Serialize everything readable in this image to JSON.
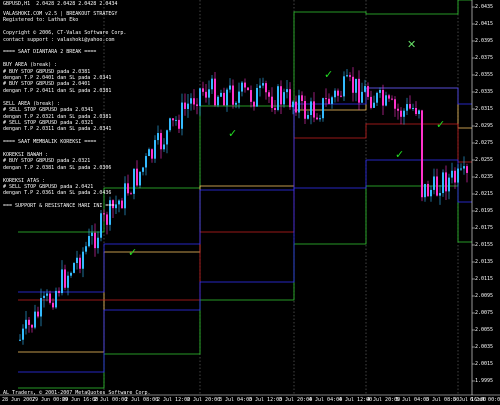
{
  "header": {
    "title": "GBPUSD,H1  2.0428 2.0428 2.0428 2.0434"
  },
  "info_lines": [
    "VALASHOKI.COM v2.5 | BREAKOUT STRATEGY",
    "Registered to: Lathan Eko",
    "",
    "Copyright © 2006, CT-Valas Software Corp.",
    "contact support : valashoki@yahoo.com",
    "",
    "==== SAAT DIANTARA 2 BREAK ====",
    "",
    "BUY AREA (break) :",
    "# BUY STOP GBPUSD pada 2.0381",
    "dengan T.P 2.0401 dan SL pada 2.0341",
    "# BUY STOP GBPUSD pada 2.0401",
    "dengan T.P 2.0411 dan SL pada 2.0381",
    "",
    "SELL AREA (break) :",
    "# SELL STOP GBPUSD pada 2.0341",
    "dengan T.P 2.0321 dan SL pada 2.0381",
    "# SELL STOP GBPUSD pada 2.0321",
    "dengan T.P 2.0311 dan SL pada 2.0341",
    "",
    "==== SAAT MEMBALIK KOREKSI ====",
    "",
    "KOREKSI BAWAH :",
    "# BUY STOP GBPUSD pada 2.0321",
    "dengan T.P 2.0381 dan SL pada 2.0306",
    "",
    "KOREKSI ATAS :",
    "# SELL STOP GBPUSD pada 2.0421",
    "dengan T.P 2.0361 dan SL pada 2.0436",
    "",
    "=== SUPPORT & RESISTANCE HARI INI ==="
  ],
  "footer": "AL Traders, © 2001-2007 MetaQuotes Software Corp.",
  "price_labels": [
    "2.0435",
    "2.0415",
    "2.0395",
    "2.0375",
    "2.0355",
    "2.0335",
    "2.0315",
    "2.0295",
    "2.0275",
    "2.0255",
    "2.0235",
    "2.0215",
    "2.0195",
    "2.0175",
    "2.0155",
    "2.0135",
    "2.0115",
    "2.0095",
    "2.0075",
    "2.0055",
    "2.0035",
    "2.0015",
    "1.9995"
  ],
  "time_labels": [
    "28 Jun 2007",
    "29 Jun 00:00",
    "29 Jun 16:00",
    "2 Jul 00:00",
    "2 Jul 08:00",
    "2 Jul 12:00",
    "2 Jul 20:00",
    "3 Jul 04:00",
    "3 Jul 12:00",
    "3 Jul 20:00",
    "4 Jul 04:00",
    "4 Jul 12:00",
    "4 Jul 20:00",
    "5 Jul 04:00",
    "5 Jul 08:00",
    "5 Jul 16:00",
    "6 Jul 00:00"
  ],
  "marks": {
    "check": "✓",
    "cross": "✕"
  },
  "colors": {
    "background": "#000000",
    "bull": "#33bbff",
    "bear": "#ff33cc",
    "green": "#33cc33",
    "orange": "#ffcc66",
    "red": "#cc2222",
    "blue": "#3333ff",
    "check": "#22dd22",
    "cross": "#66dd66"
  }
}
